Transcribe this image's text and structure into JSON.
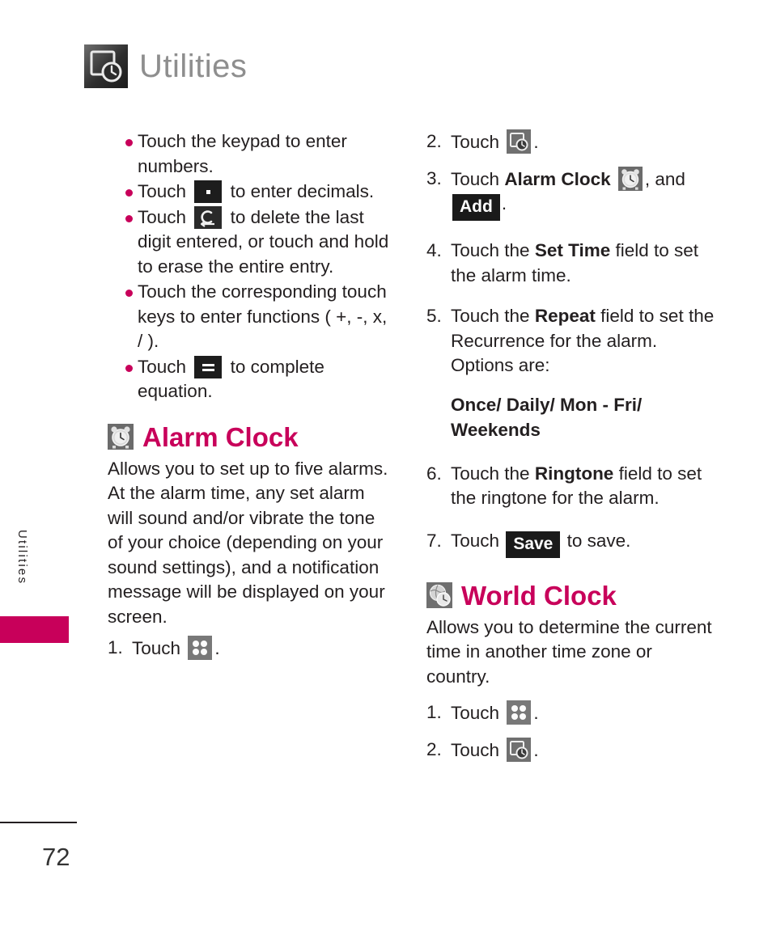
{
  "header": {
    "title": "Utilities",
    "icon": "utilities-clock-icon"
  },
  "side_tab": {
    "label": "Utilities"
  },
  "footer": {
    "page_number": "72"
  },
  "colors": {
    "accent": "#c8005a",
    "text": "#231f20",
    "header_gray": "#8e8e8e",
    "chip_bg": "#1a1a1a"
  },
  "left_column": {
    "bullets": [
      {
        "id": "keypad-numbers",
        "parts": [
          {
            "type": "text",
            "value": "Touch the keypad to enter numbers."
          }
        ]
      },
      {
        "id": "decimal-key",
        "parts": [
          {
            "type": "text",
            "value": "Touch "
          },
          {
            "type": "icon",
            "value": "decimal-point-key-icon"
          },
          {
            "type": "text",
            "value": " to enter decimals."
          }
        ]
      },
      {
        "id": "clear-key",
        "parts": [
          {
            "type": "text",
            "value": "Touch "
          },
          {
            "type": "icon",
            "value": "clear-backspace-key-icon"
          },
          {
            "type": "text",
            "value": " to delete the last digit entered, or touch and hold to erase the entire entry."
          }
        ]
      },
      {
        "id": "function-keys",
        "parts": [
          {
            "type": "text",
            "value": "Touch the corresponding touch keys to enter functions ( +, -, x, / )."
          }
        ]
      },
      {
        "id": "equals-key",
        "parts": [
          {
            "type": "text",
            "value": "Touch "
          },
          {
            "type": "icon",
            "value": "equals-key-icon"
          },
          {
            "type": "text",
            "value": " to complete equation."
          }
        ]
      }
    ],
    "bullet_texts": {
      "b1": "Touch the keypad to enter numbers.",
      "b2_pre": "Touch",
      "b2_post": "to enter decimals.",
      "b3_pre": "Touch",
      "b3_post": "to delete the last digit entered, or touch and hold to erase the entire entry.",
      "b4": "Touch the corresponding touch keys to enter functions ( +, -, x, / ).",
      "b5_pre": "Touch",
      "b5_post": "to complete equation."
    },
    "alarm_clock": {
      "heading": "Alarm Clock",
      "heading_icon": "alarm-clock-icon",
      "description": "Allows you to set up to five alarms. At the alarm time, any set alarm will sound and/or vibrate the tone of your choice (depending on your sound settings), and a notification message will be displayed on your screen.",
      "step1_marker": "1.",
      "step1_pre": "Touch",
      "step1_icon": "menu-grid-icon",
      "step1_post": "."
    }
  },
  "right_column": {
    "alarm_steps": {
      "step2": {
        "marker": "2.",
        "pre": "Touch",
        "icon": "utilities-clock-icon",
        "post": "."
      },
      "step3": {
        "marker": "3.",
        "pre": "Touch",
        "bold": "Alarm Clock",
        "icon": "alarm-clock-icon",
        "mid": ", and",
        "chip": "Add",
        "post": "."
      },
      "step4": {
        "marker": "4.",
        "pre": "Touch the",
        "bold": "Set Time",
        "post": "field to set the alarm time."
      },
      "step5": {
        "marker": "5.",
        "pre": "Touch the",
        "bold": "Repeat",
        "post": "field to set the Recurrence for the alarm. Options are:",
        "options": "Once/ Daily/ Mon - Fri/ Weekends"
      },
      "step6": {
        "marker": "6.",
        "pre": "Touch the",
        "bold": "Ringtone",
        "post": "field to set the ringtone for the alarm."
      },
      "step7": {
        "marker": "7.",
        "pre": "Touch",
        "chip": "Save",
        "post": "to save."
      }
    },
    "world_clock": {
      "heading": "World Clock",
      "heading_icon": "world-clock-globe-icon",
      "description": "Allows you to determine the current time in another time zone or country.",
      "step1": {
        "marker": "1.",
        "pre": "Touch",
        "icon": "menu-grid-icon",
        "post": "."
      },
      "step2": {
        "marker": "2.",
        "pre": "Touch",
        "icon": "utilities-clock-icon",
        "post": "."
      }
    }
  }
}
